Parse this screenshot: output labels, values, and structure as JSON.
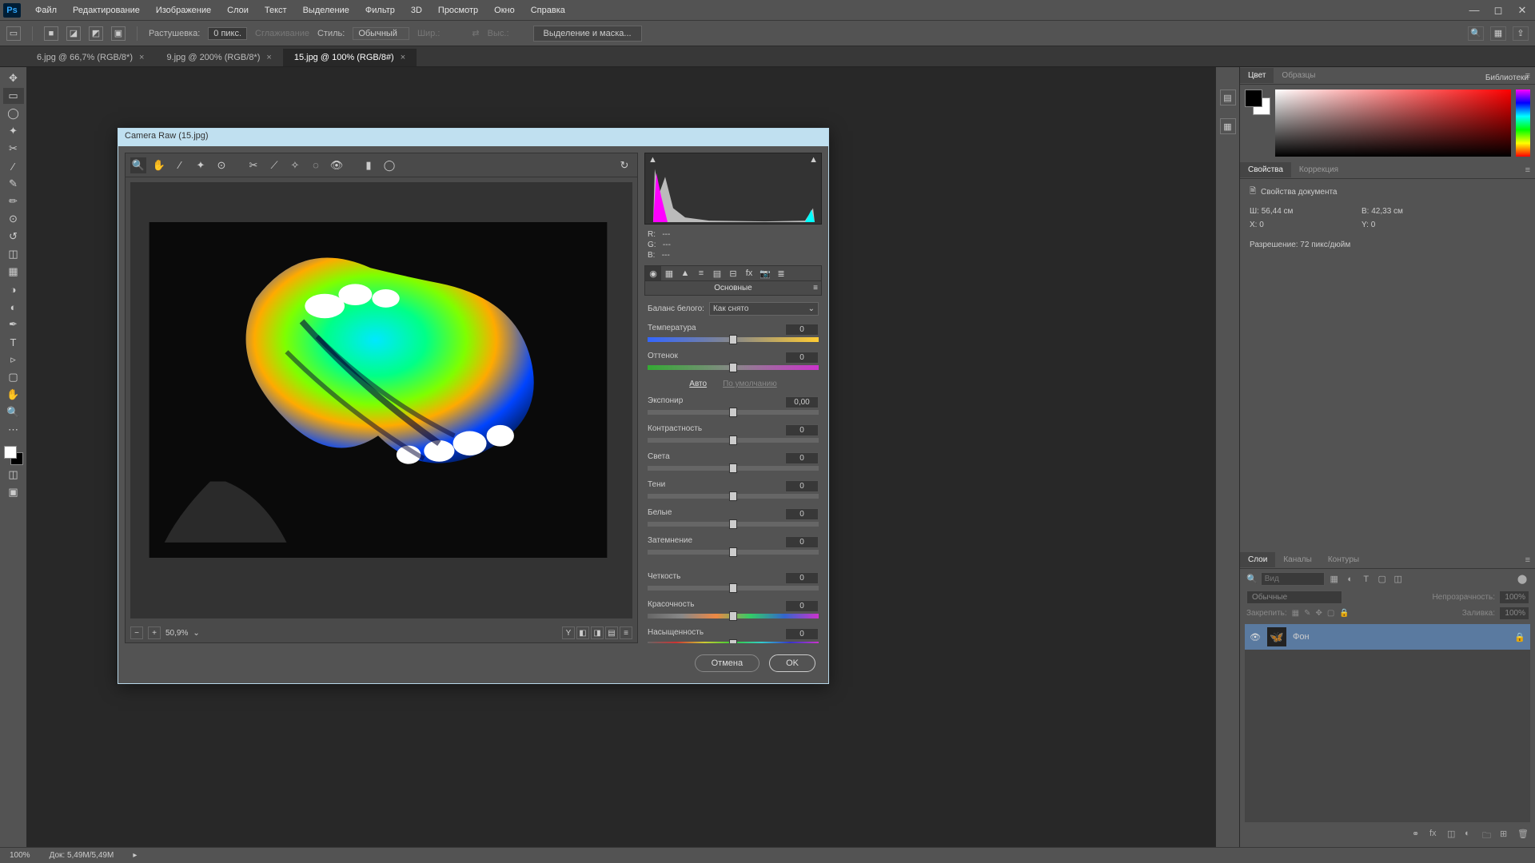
{
  "menu": {
    "items": [
      "Файл",
      "Редактирование",
      "Изображение",
      "Слои",
      "Текст",
      "Выделение",
      "Фильтр",
      "3D",
      "Просмотр",
      "Окно",
      "Справка"
    ]
  },
  "optbar": {
    "feather_label": "Растушевка:",
    "feather_val": "0 пикс.",
    "smooth": "Сглаживание",
    "style_label": "Стиль:",
    "style_val": "Обычный",
    "w": "Шир.:",
    "h": "Выс.:",
    "mask": "Выделение и маска..."
  },
  "tabs": [
    {
      "label": "6.jpg @ 66,7% (RGB/8*)",
      "active": false
    },
    {
      "label": "9.jpg @ 200% (RGB/8*)",
      "active": false
    },
    {
      "label": "15.jpg @ 100% (RGB/8#)",
      "active": true
    }
  ],
  "rpanel": {
    "colorTabs": [
      "Цвет",
      "Образцы"
    ],
    "libraries": "Библиотеки",
    "propTabs": [
      "Свойства",
      "Коррекция"
    ],
    "propTitle": "Свойства документа",
    "w_label": "Ш:",
    "w_val": "56,44 см",
    "h_label": "В:",
    "h_val": "42,33 см",
    "x_label": "X:",
    "x_val": "0",
    "y_label": "Y:",
    "y_val": "0",
    "res": "Разрешение: 72 пикс/дюйм",
    "layerTabs": [
      "Слои",
      "Каналы",
      "Контуры"
    ],
    "search_placeholder": "Вид",
    "blend": "Обычные",
    "opacity_label": "Непрозрачность:",
    "opacity": "100%",
    "lock_label": "Закрепить:",
    "fill_label": "Заливка:",
    "fill": "100%",
    "layer_name": "Фон"
  },
  "status": {
    "zoom": "100%",
    "doc": "Док: 5,49M/5,49M"
  },
  "camraw": {
    "title": "Camera Raw (15.jpg)",
    "rgb": {
      "r": "R:",
      "g": "G:",
      "b": "B:",
      "dash": "---"
    },
    "panel_head": "Основные",
    "wb_label": "Баланс белого:",
    "wb_val": "Как снято",
    "sliders": [
      {
        "name": "Температура",
        "val": "0",
        "track": "temp"
      },
      {
        "name": "Оттенок",
        "val": "0",
        "track": "tint"
      }
    ],
    "auto": "Авто",
    "default": "По умолчанию",
    "sliders2": [
      {
        "name": "Экспонир",
        "val": "0,00"
      },
      {
        "name": "Контрастность",
        "val": "0"
      },
      {
        "name": "Света",
        "val": "0"
      },
      {
        "name": "Тени",
        "val": "0"
      },
      {
        "name": "Белые",
        "val": "0"
      },
      {
        "name": "Затемнение",
        "val": "0"
      }
    ],
    "sliders3": [
      {
        "name": "Четкость",
        "val": "0"
      },
      {
        "name": "Красочность",
        "val": "0",
        "track": "vib"
      },
      {
        "name": "Насыщенность",
        "val": "0",
        "track": "sat"
      }
    ],
    "zoom": "50,9%",
    "cancel": "Отмена",
    "ok": "OK"
  }
}
